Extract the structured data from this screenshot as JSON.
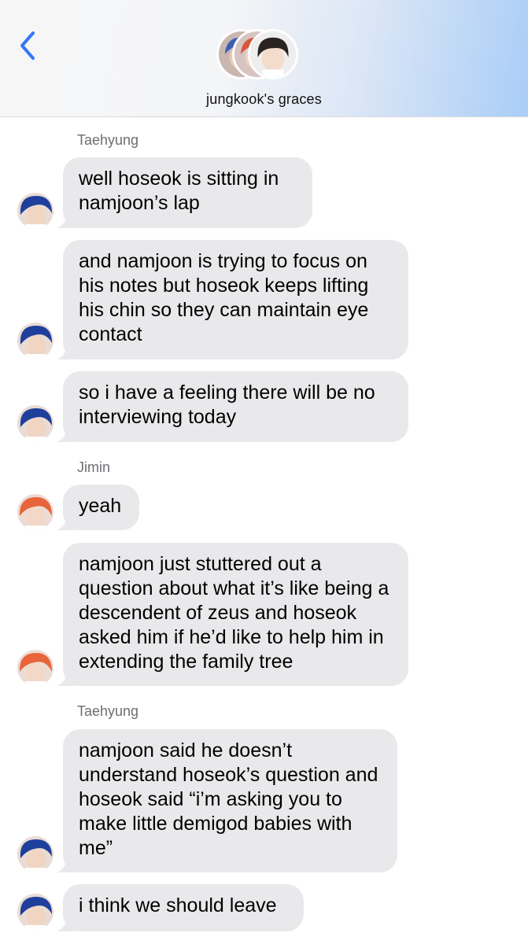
{
  "header": {
    "group_name": "jungkook's graces",
    "back_icon": "chevron-left-icon",
    "accent_color": "#3478f6"
  },
  "messages": [
    {
      "sender": "Taehyung",
      "text": "well hoseok is sitting in namjoon’s lap"
    },
    {
      "text": "and namjoon is trying to focus on his notes but hoseok keeps lifting his chin so they can maintain eye contact"
    },
    {
      "text": "so i have a feeling there will be no interviewing today"
    },
    {
      "sender": "Jimin",
      "text": "yeah"
    },
    {
      "text": "namjoon just stuttered out a question about what it’s like being a descendent of zeus and hoseok asked him if he’d like to help him in extending the family tree"
    },
    {
      "sender": "Taehyung",
      "text": "namjoon said he doesn’t understand hoseok’s question and hoseok said “i’m asking you to make little demigod babies with me”"
    },
    {
      "text": "i think we should leave"
    }
  ],
  "colors": {
    "bubble": "#e9e9eb",
    "sender_label": "#6e6e73",
    "taehyung_hair": "#1f3f9c",
    "jimin_hair": "#e8643a"
  }
}
